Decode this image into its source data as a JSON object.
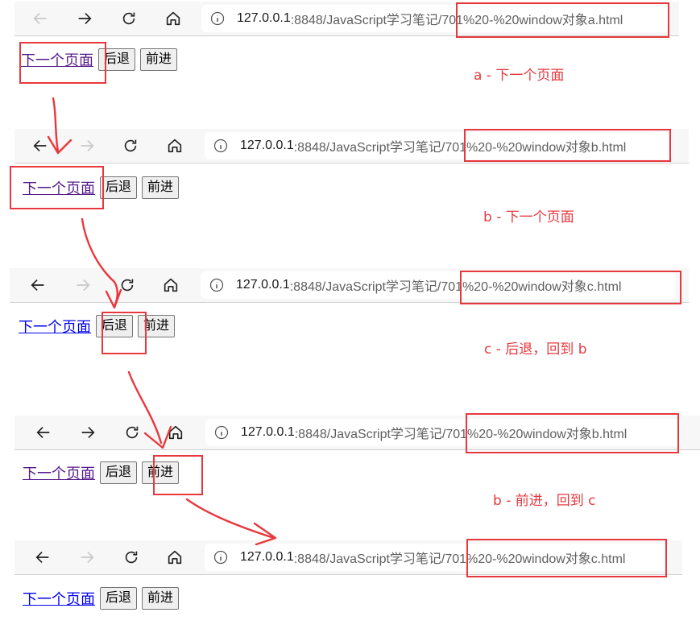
{
  "url_host": "127.0.0.1",
  "steps": [
    {
      "url_path": ":8848/JavaScript学习笔记/701%20-%20window对象a.html",
      "link": "下一个页面",
      "back": "后退",
      "forward": "前进",
      "note": "a - 下一个页面"
    },
    {
      "url_path": ":8848/JavaScript学习笔记/701%20-%20window对象b.html",
      "link": "下一个页面",
      "back": "后退",
      "forward": "前进",
      "note": "b - 下一个页面"
    },
    {
      "url_path": ":8848/JavaScript学习笔记/701%20-%20window对象c.html",
      "link": "下一个页面",
      "back": "后退",
      "forward": "前进",
      "note": "c - 后退，回到 b"
    },
    {
      "url_path": ":8848/JavaScript学习笔记/701%20-%20window对象b.html",
      "link": "下一个页面",
      "back": "后退",
      "forward": "前进",
      "note": "b - 前进，回到 c"
    },
    {
      "url_path": ":8848/JavaScript学习笔记/701%20-%20window对象c.html",
      "link": "下一个页面",
      "back": "后退",
      "forward": "前进"
    }
  ],
  "icons": {
    "back": "back-arrow-icon",
    "forward": "forward-arrow-icon",
    "reload": "reload-icon",
    "home": "home-icon",
    "info": "info-icon"
  },
  "colors": {
    "annotation": "#e8383d",
    "link_visited": "#551a8b",
    "link_unvisited": "#0000ee"
  }
}
